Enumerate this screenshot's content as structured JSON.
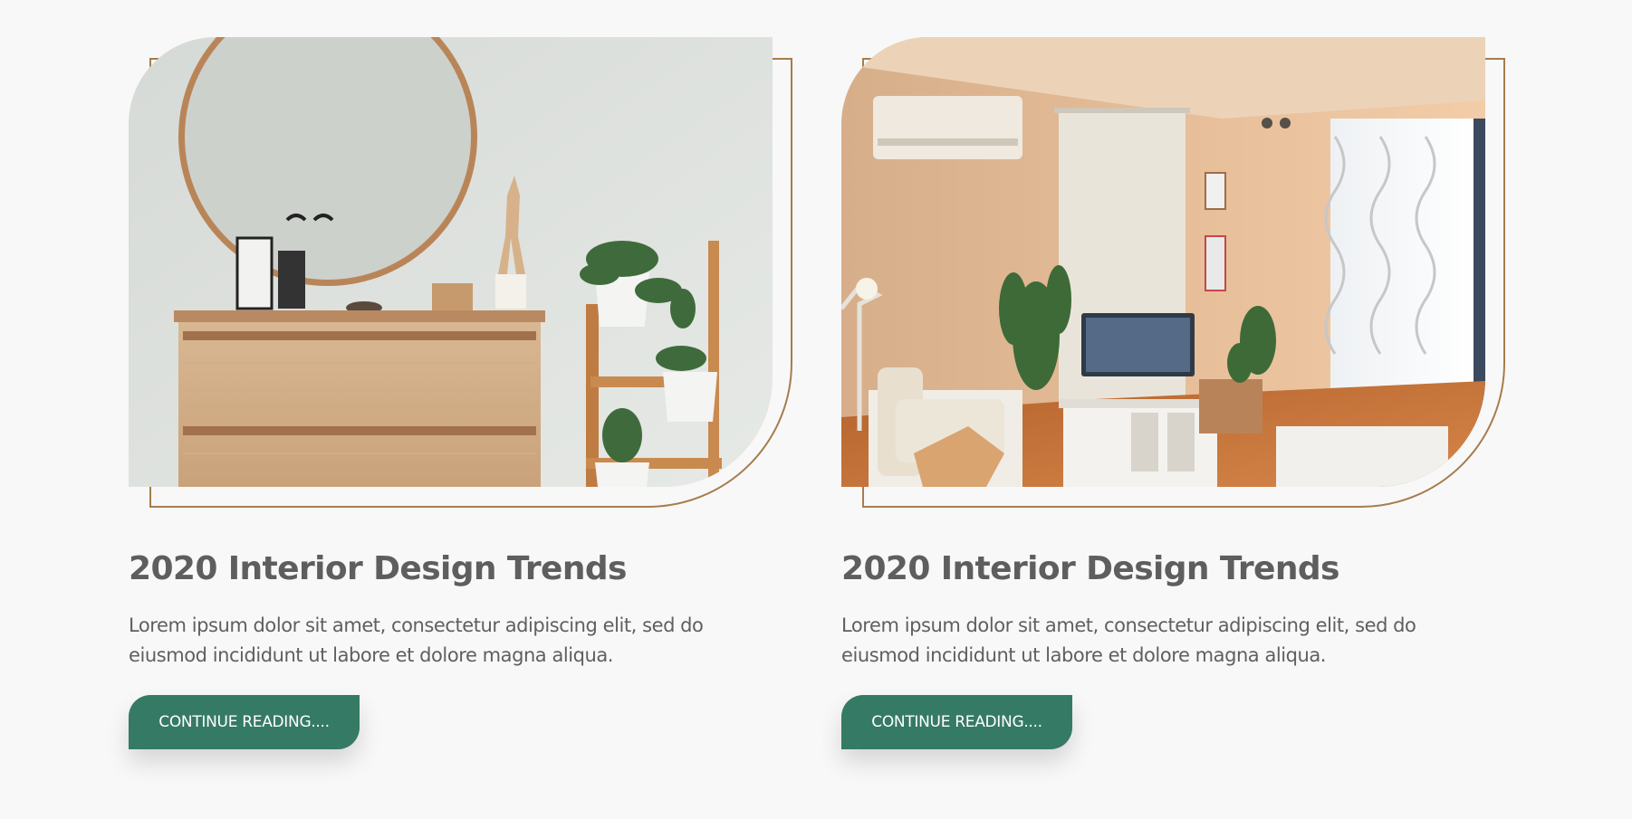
{
  "posts": [
    {
      "image_alt": "Bedroom corner with round mirror, wooden dresser and plant ladder",
      "title": "2020 Interior Design Trends",
      "excerpt": "Lorem ipsum dolor sit amet, consectetur adipiscing elit, sed do eiusmod incididunt ut labore et dolore magna aliqua.",
      "button_label": "CONTINUE READING...."
    },
    {
      "image_alt": "Warm living room with TV, armchair, plants and sheer curtains",
      "title": "2020 Interior Design Trends",
      "excerpt": "Lorem ipsum dolor sit amet, consectetur adipiscing elit, sed do eiusmod incididunt ut labore et dolore magna aliqua.",
      "button_label": "CONTINUE READING...."
    }
  ],
  "colors": {
    "accent": "#357a64",
    "frame": "#a77c4e",
    "background": "#f8f8f8",
    "text": "#5f5f5f"
  }
}
